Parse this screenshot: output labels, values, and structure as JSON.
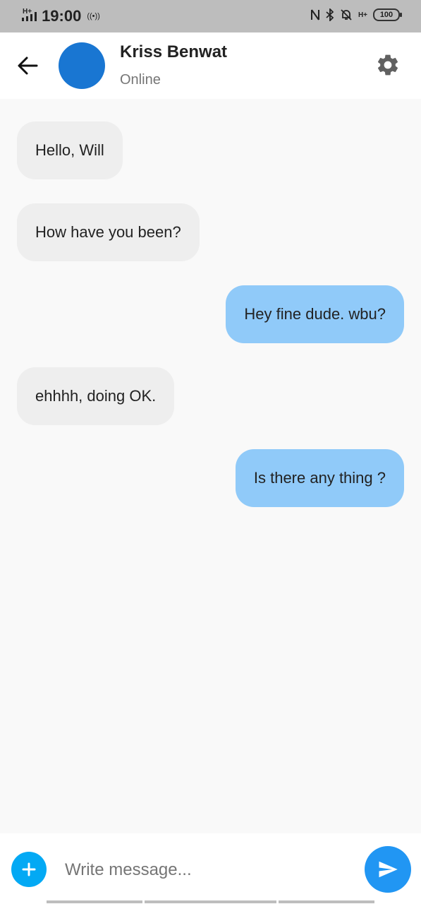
{
  "status_bar": {
    "time": "19:00",
    "network_left": "H+",
    "network_right": "H+",
    "battery": "100",
    "icons": [
      "signal-icon",
      "hotspot-icon",
      "nfc-icon",
      "bluetooth-icon",
      "bell-off-icon",
      "battery-icon"
    ]
  },
  "header": {
    "contact_name": "Kriss Benwat",
    "contact_status": "Online",
    "avatar_color": "#1976d2",
    "icons": [
      "arrow-back-icon",
      "gear-icon"
    ]
  },
  "messages": [
    {
      "text": "Hello, Will",
      "direction": "incoming"
    },
    {
      "text": "How have you been?",
      "direction": "incoming"
    },
    {
      "text": "Hey fine dude. wbu?",
      "direction": "outgoing"
    },
    {
      "text": "ehhhh, doing OK.",
      "direction": "incoming"
    },
    {
      "text": "Is there any thing ?",
      "direction": "outgoing"
    }
  ],
  "composer": {
    "placeholder": "Write message...",
    "value": "",
    "icons": [
      "add-icon",
      "send-icon"
    ]
  },
  "colors": {
    "incoming_bubble": "#eeeeee",
    "outgoing_bubble": "#90caf9",
    "add_button": "#03a9f4",
    "send_button": "#2196f3",
    "status_bar": "#bdbdbd"
  }
}
